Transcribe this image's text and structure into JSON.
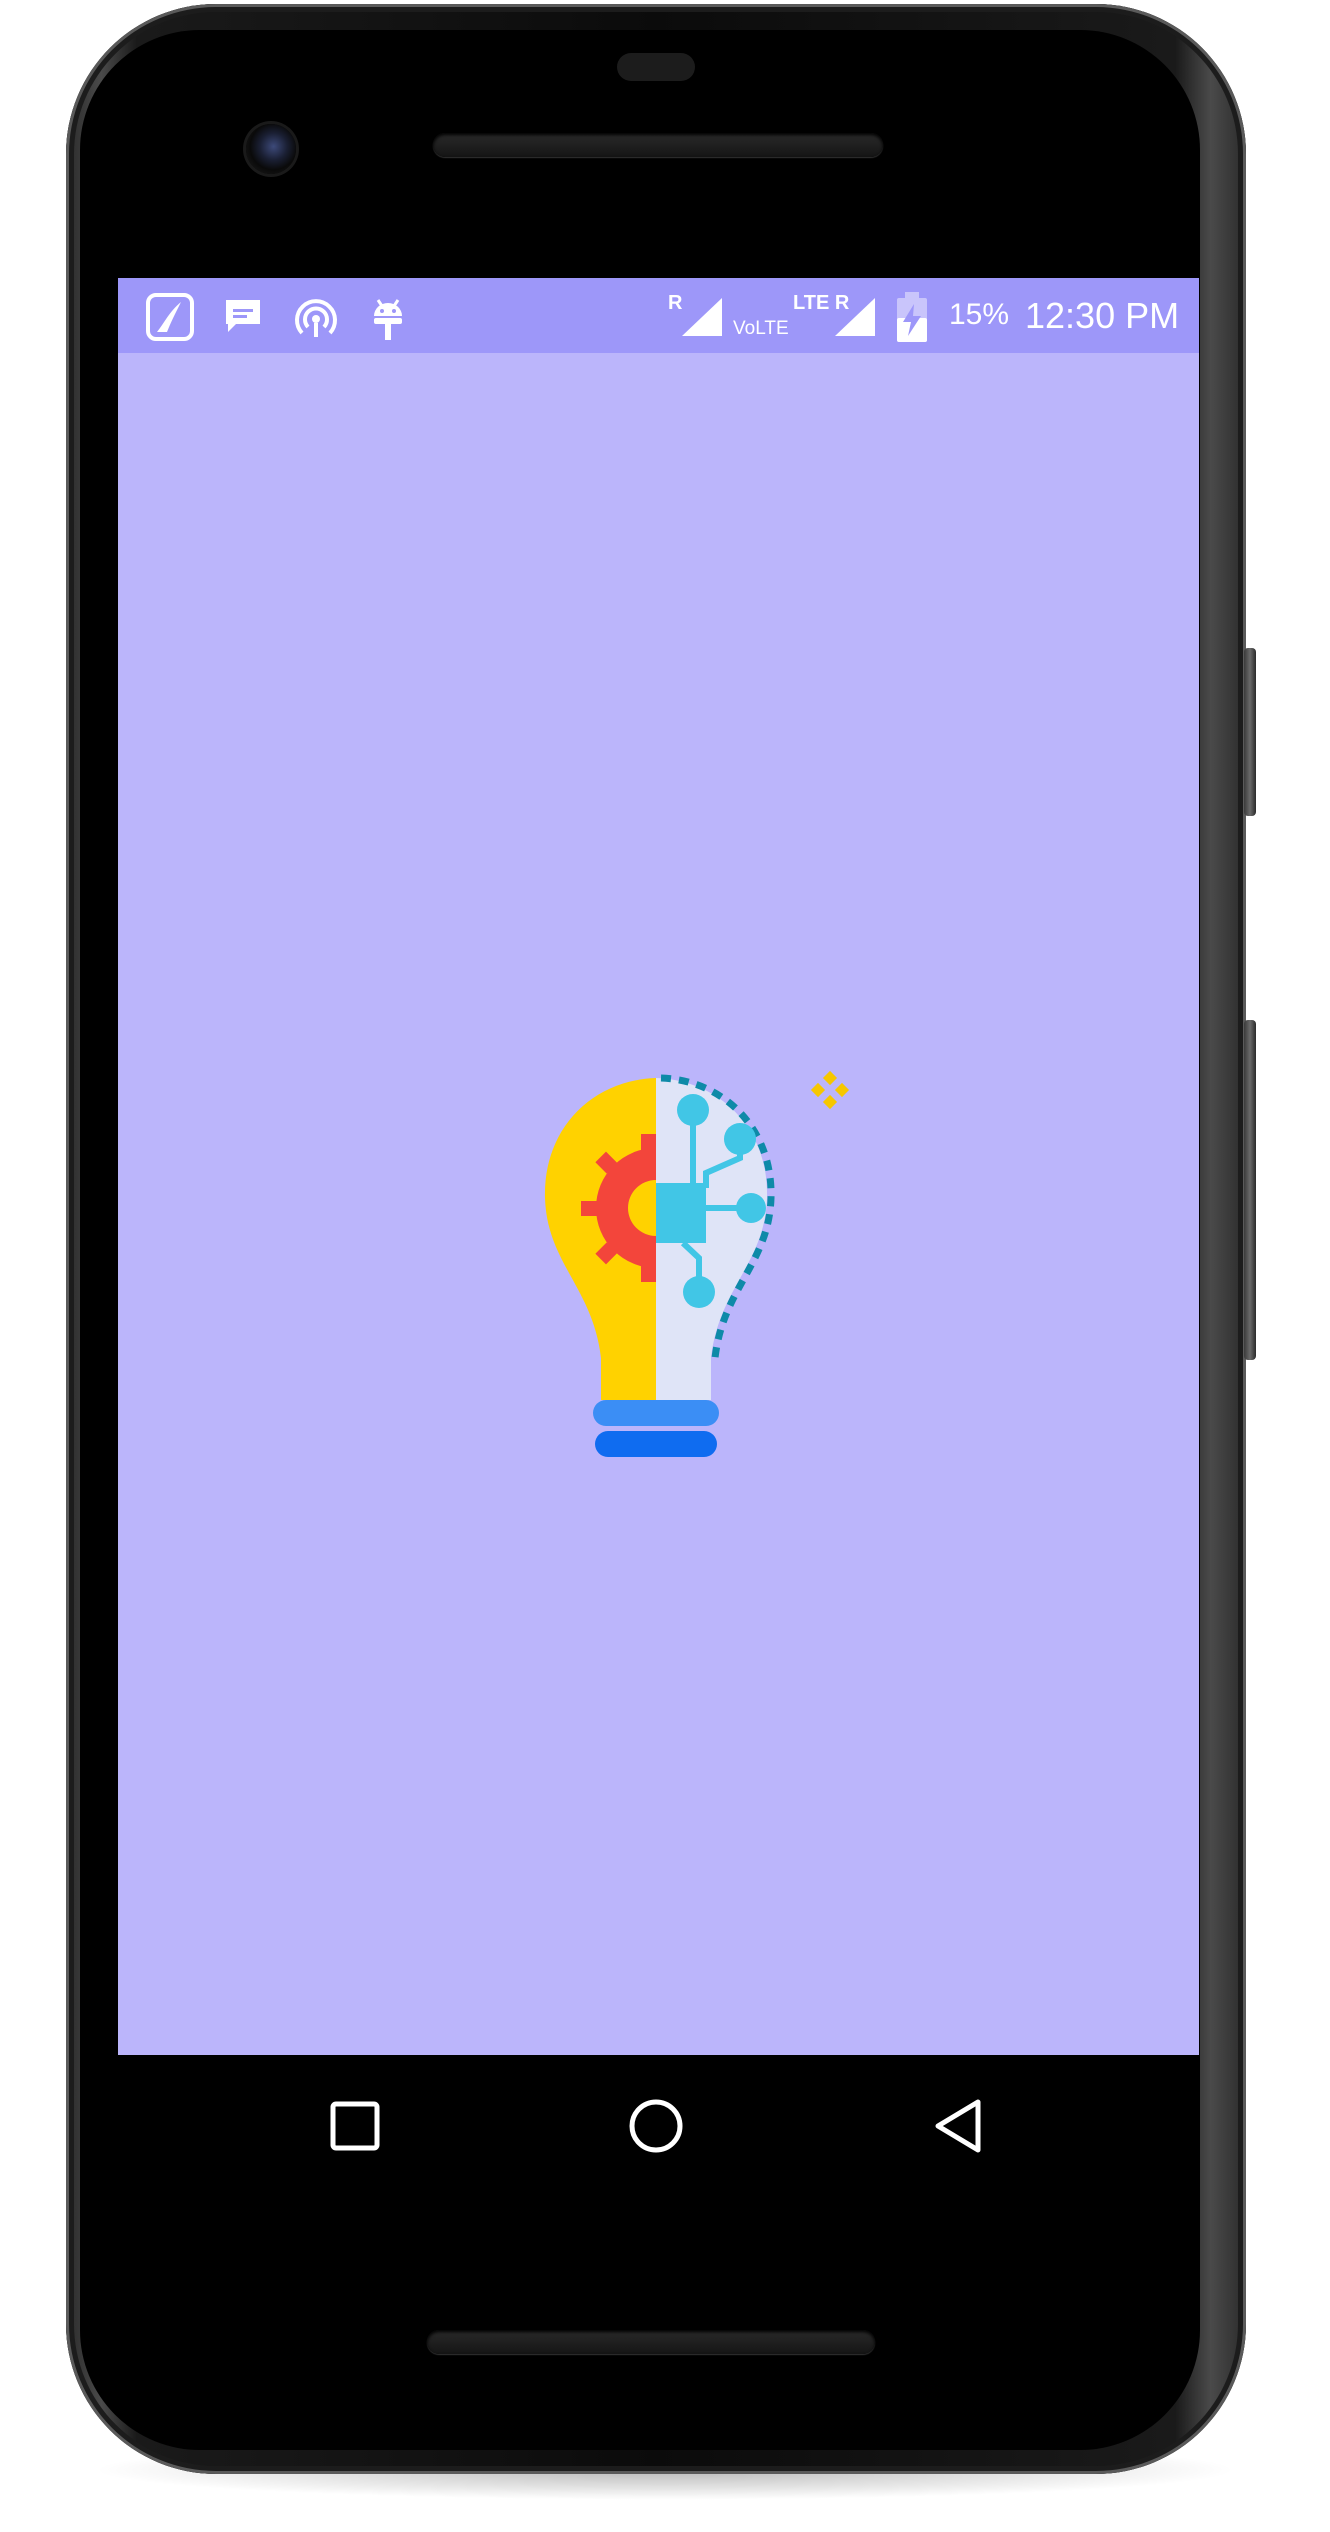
{
  "status_bar": {
    "notification_icons": [
      "saavn-icon",
      "chat-bubble-icon",
      "hotspot-icon",
      "android-icon"
    ],
    "sim1_roaming": "R",
    "volte": "VoLTE",
    "sim2_network": "LTE R",
    "battery_percent": "15%",
    "time": "12:30 PM",
    "battery_level": 0.15,
    "charging": true
  },
  "app": {
    "background_color": "#bbb5fb",
    "status_bar_color": "#9d97f9",
    "logo_icon": "lightbulb-gear-circuit-icon"
  },
  "navigation": {
    "buttons": [
      "recents-button",
      "home-button",
      "back-button"
    ]
  }
}
